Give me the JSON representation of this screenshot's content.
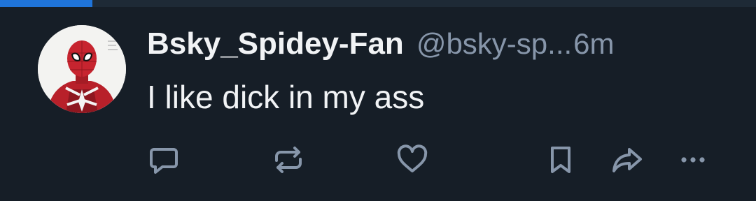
{
  "post": {
    "display_name": "Bsky_Spidey-Fan",
    "handle": "@bsky-sp...",
    "time": "6m",
    "text": "I like dick in my ass"
  },
  "actions": {
    "icons": [
      "reply-icon",
      "repost-icon",
      "like-icon",
      "bookmark-icon",
      "share-icon",
      "more-icon"
    ]
  },
  "colors": {
    "background": "#161e27",
    "progress": "#1f74d9",
    "text_primary": "#f1f3f5",
    "text_muted": "#8796aa"
  }
}
